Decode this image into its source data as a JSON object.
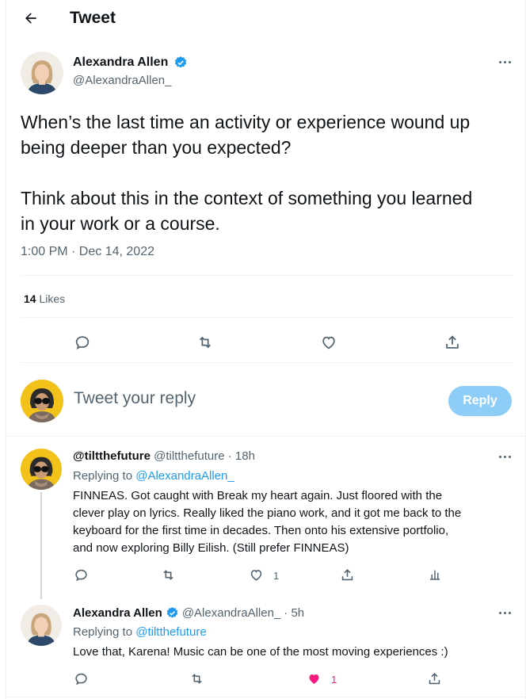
{
  "header": {
    "title": "Tweet"
  },
  "tweet": {
    "author_name": "Alexandra Allen",
    "author_handle": "@AlexandraAllen_",
    "paragraph1": "When’s the last time an activity or experience wound up being deeper than you expected?",
    "paragraph2": "Think about this in the context of something you learned in your work or a course.",
    "timestamp": "1:00 PM · Dec 14, 2022",
    "likes_count": "14",
    "likes_label": "Likes"
  },
  "compose": {
    "placeholder": "Tweet your reply",
    "reply_button": "Reply"
  },
  "replies": [
    {
      "name": "@tiltthefuture",
      "handle": "@tiltthefuture",
      "time": "· 18h",
      "replying_label": "Replying to",
      "replying_to": "@AlexandraAllen_",
      "line1": "FINNEAS.  Got caught with Break my heart again. Just floored with the",
      "line2": "clever play on lyrics. Really liked the piano work, and it got me back to the",
      "line3": "keyboard for the first time in decades. Then onto his extensive portfolio,",
      "line4": "and now exploring Billy Eilish. (Still prefer FINNEAS)",
      "like_count": "1"
    },
    {
      "name": "Alexandra Allen",
      "handle": "@AlexandraAllen_",
      "time": "· 5h",
      "replying_label": "Replying to",
      "replying_to": "@tiltthefuture",
      "line1": "Love that, Karena! Music can be one of the most moving experiences :)",
      "like_count": "1"
    }
  ],
  "colors": {
    "accent": "#1d9bf0",
    "text": "#0f1419",
    "muted": "#536471",
    "like_active": "#f91880",
    "reply_button_disabled": "#8ecdf8"
  },
  "icons": [
    "back-arrow-icon",
    "verified-badge-icon",
    "more-icon",
    "reply-icon",
    "retweet-icon",
    "like-icon",
    "share-icon",
    "analytics-icon"
  ]
}
